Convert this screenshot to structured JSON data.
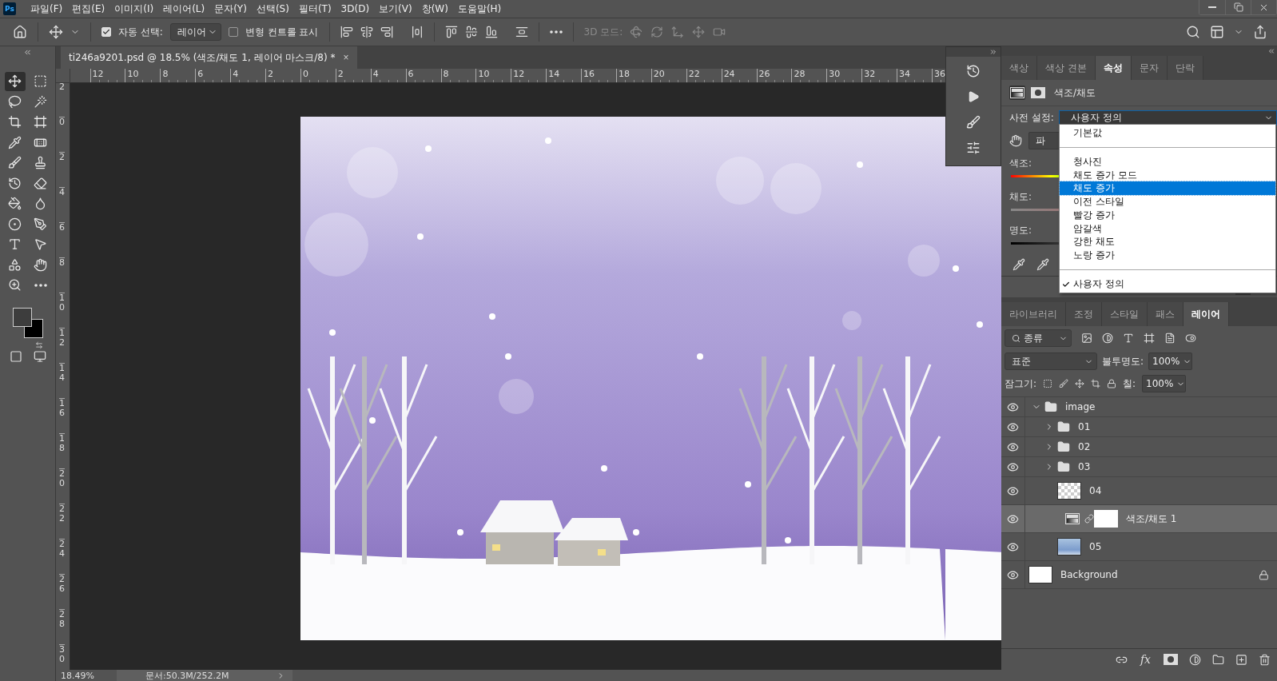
{
  "app": {
    "logo": "Ps"
  },
  "menu": [
    "파일(F)",
    "편집(E)",
    "이미지(I)",
    "레이어(L)",
    "문자(Y)",
    "선택(S)",
    "필터(T)",
    "3D(D)",
    "보기(V)",
    "창(W)",
    "도움말(H)"
  ],
  "options": {
    "auto_select": {
      "label": "자동 선택:",
      "checked": true
    },
    "target": "레이어",
    "transform": {
      "label": "변형 컨트롤 표시",
      "checked": false
    },
    "mode_3d": {
      "label": "3D 모드:",
      "disabled": true
    }
  },
  "document_tab": {
    "title": "ti246a9201.psd @ 18.5% (색조/채도 1, 레이어 마스크/8) *",
    "close": "×"
  },
  "rulers": {
    "horizontal": [
      "12",
      "10",
      "8",
      "6",
      "4",
      "2",
      "0",
      "2",
      "4",
      "6",
      "8",
      "10",
      "12",
      "14",
      "16",
      "18",
      "20",
      "22",
      "24",
      "26",
      "28",
      "30",
      "32",
      "34",
      "36"
    ],
    "vertical": [
      "2",
      "0",
      "2",
      "4",
      "6",
      "8",
      "10",
      "12",
      "14",
      "16",
      "18",
      "20",
      "22",
      "24",
      "26",
      "28",
      "30"
    ]
  },
  "status_bar": {
    "zoom": "18.49%",
    "document": "문서:50.3M/252.2M"
  },
  "properties": {
    "tabs": [
      {
        "label": "색상",
        "selected": false
      },
      {
        "label": "색상 견본",
        "selected": false
      },
      {
        "label": "속성",
        "selected": true
      },
      {
        "label": "문자",
        "selected": false
      },
      {
        "label": "단락",
        "selected": false
      }
    ],
    "title": "색조/채도",
    "preset_label": "사전 설정:",
    "preset_value": "사용자 정의",
    "channel_value": "파",
    "sliders": [
      {
        "label": "색조:",
        "kind": "hue"
      },
      {
        "label": "채도:",
        "kind": "saturation"
      },
      {
        "label": "명도:",
        "kind": "lightness"
      }
    ],
    "preset_menu": [
      {
        "kind": "item",
        "label": "기본값",
        "selected": false,
        "checked": false
      },
      {
        "kind": "separator"
      },
      {
        "kind": "item",
        "label": "청사진",
        "selected": false,
        "checked": false
      },
      {
        "kind": "item",
        "label": "채도 증가 모드",
        "selected": false,
        "checked": false
      },
      {
        "kind": "item",
        "label": "채도 증가",
        "selected": true,
        "checked": false
      },
      {
        "kind": "item",
        "label": "이전 스타일",
        "selected": false,
        "checked": false
      },
      {
        "kind": "item",
        "label": "빨강 증가",
        "selected": false,
        "checked": false
      },
      {
        "kind": "item",
        "label": "암갈색",
        "selected": false,
        "checked": false
      },
      {
        "kind": "item",
        "label": "강한 채도",
        "selected": false,
        "checked": false
      },
      {
        "kind": "item",
        "label": "노랑 증가",
        "selected": false,
        "checked": false
      },
      {
        "kind": "separator"
      },
      {
        "kind": "item",
        "label": "사용자 정의",
        "selected": false,
        "checked": true
      }
    ]
  },
  "layers": {
    "tabs": [
      {
        "label": "라이브러리",
        "selected": false
      },
      {
        "label": "조정",
        "selected": false
      },
      {
        "label": "스타일",
        "selected": false
      },
      {
        "label": "패스",
        "selected": false
      },
      {
        "label": "레이어",
        "selected": true
      }
    ],
    "filter": "종류",
    "blend": "표준",
    "opacity_label": "불투명도:",
    "opacity": "100%",
    "lock_label": "잠그기:",
    "fill_label": "칠:",
    "fill": "100%",
    "effects": "fx",
    "items": [
      {
        "name": "image",
        "kind": "group",
        "expanded": true,
        "visible": true,
        "selected": false,
        "locked": false,
        "children": [
          {
            "name": "01",
            "kind": "group",
            "expanded": false,
            "visible": true,
            "selected": false,
            "locked": false
          },
          {
            "name": "02",
            "kind": "group",
            "expanded": false,
            "visible": true,
            "selected": false,
            "locked": false
          },
          {
            "name": "03",
            "kind": "group",
            "expanded": false,
            "visible": true,
            "selected": false,
            "locked": false
          },
          {
            "name": "04",
            "kind": "pixel",
            "visible": true,
            "selected": false,
            "locked": false
          },
          {
            "name": "색조/채도 1",
            "kind": "adjustment",
            "visible": true,
            "selected": true,
            "locked": false
          },
          {
            "name": "05",
            "kind": "photo",
            "visible": true,
            "selected": false,
            "locked": false
          }
        ]
      },
      {
        "name": "Background",
        "kind": "background",
        "visible": true,
        "selected": false,
        "locked": true
      }
    ]
  }
}
